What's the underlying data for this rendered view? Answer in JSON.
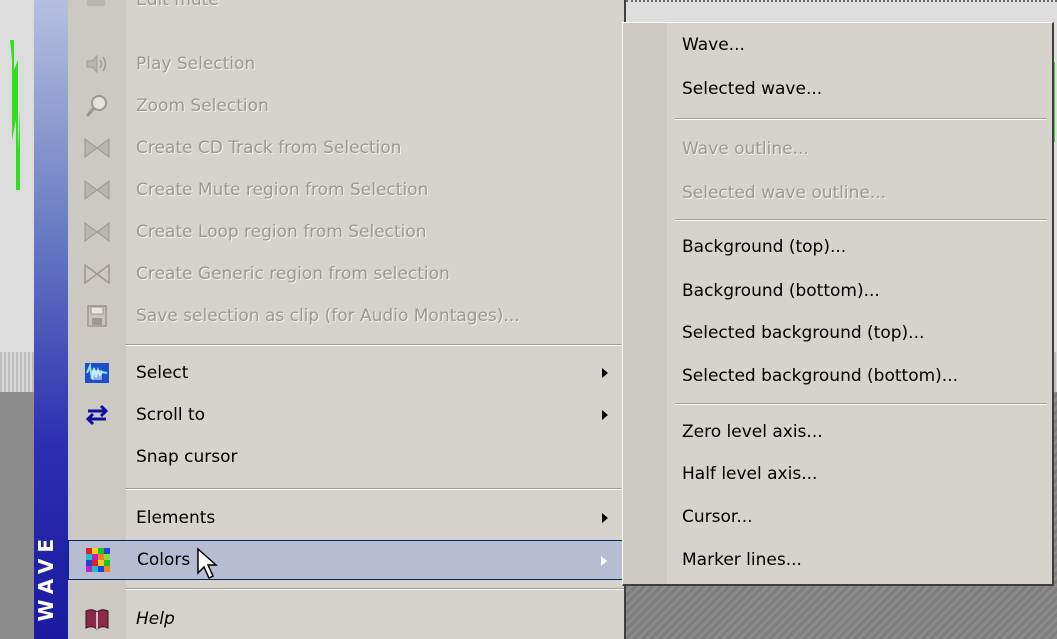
{
  "banner": {
    "text": "WAVE"
  },
  "main_menu": {
    "items": [
      {
        "label": "Edit mute",
        "disabled": true,
        "icon": "mute-icon"
      },
      {
        "label": "Play Selection",
        "disabled": true,
        "icon": "speaker-icon"
      },
      {
        "label": "Zoom Selection",
        "disabled": true,
        "icon": "magnifier-icon"
      },
      {
        "label": "Create CD Track from Selection",
        "disabled": true,
        "icon": "bowtie-icon"
      },
      {
        "label": "Create Mute region from Selection",
        "disabled": true,
        "icon": "bowtie-icon"
      },
      {
        "label": "Create Loop region from Selection",
        "disabled": true,
        "icon": "bowtie-icon"
      },
      {
        "label": "Create Generic region from selection",
        "disabled": true,
        "icon": "bowtie-outline-icon"
      },
      {
        "label": "Save selection as clip (for Audio Montages)...",
        "disabled": true,
        "icon": "floppy-icon"
      },
      {
        "label": "Select",
        "disabled": false,
        "icon": "select-wave-icon",
        "submenu": true
      },
      {
        "label": "Scroll to",
        "disabled": false,
        "icon": "scroll-arrows-icon",
        "submenu": true
      },
      {
        "label": "Snap cursor",
        "disabled": false
      },
      {
        "label": "Elements",
        "disabled": false,
        "submenu": true
      },
      {
        "label": "Colors",
        "disabled": false,
        "icon": "color-grid-icon",
        "submenu": true,
        "highlighted": true
      },
      {
        "label": "Help",
        "disabled": false,
        "icon": "help-book-icon"
      }
    ]
  },
  "colors_submenu": {
    "items": [
      {
        "label": "Wave...",
        "disabled": false
      },
      {
        "label": "Selected wave...",
        "disabled": false
      },
      {
        "label": "Wave outline...",
        "disabled": true
      },
      {
        "label": "Selected wave outline...",
        "disabled": true
      },
      {
        "label": "Background (top)...",
        "disabled": false
      },
      {
        "label": "Background (bottom)...",
        "disabled": false
      },
      {
        "label": "Selected background (top)...",
        "disabled": false
      },
      {
        "label": "Selected background (bottom)...",
        "disabled": false
      },
      {
        "label": "Zero level axis...",
        "disabled": false
      },
      {
        "label": "Half level axis...",
        "disabled": false
      },
      {
        "label": "Cursor...",
        "disabled": false
      },
      {
        "label": "Marker lines...",
        "disabled": false
      }
    ]
  },
  "colors": {
    "menu_bg": "#d6d3ce",
    "disabled_text": "#9b9890",
    "highlight_bg": "#b6bdd2",
    "banner_dark": "#1a1aa0",
    "wave_green": "#33dd22"
  }
}
